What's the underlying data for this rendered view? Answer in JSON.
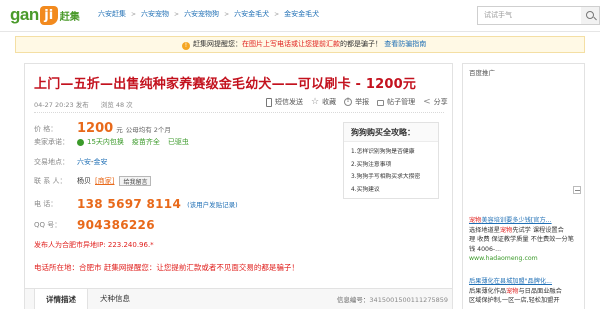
{
  "header": {
    "logo_text": "gan",
    "logo_badge": "ji",
    "logo_cn": "赶集",
    "breadcrumbs": [
      "六安赶集",
      "六安宠物",
      "六安宠物狗",
      "六安金毛犬",
      "金安金毛犬"
    ],
    "search_placeholder": "试试手气"
  },
  "notice": {
    "prefix": "赶集网提醒您：",
    "red_text": "在图片上写电话或让您提前汇款",
    "suffix": "的都是骗子！",
    "link": "查看防骗指南"
  },
  "listing": {
    "title": "上门—五折—出售纯种家养赛级金毛幼犬——可以刷卡 - 1200元",
    "date": "04-27 20:23 发布",
    "views": "浏览 48 次",
    "actions": [
      "短信发送",
      "收藏",
      "举报",
      "帖子管理",
      "分享"
    ],
    "price_label": "价    格：",
    "price": "1200",
    "price_unit": "元",
    "price_extra": "公母均有 2个月",
    "promise_label": "卖家承诺：",
    "promises": [
      "15天内包换",
      "疫苗齐全",
      "已驱虫"
    ],
    "location_label": "交易地点：",
    "location_city": "六安",
    "location_sep": " - ",
    "location_area": "金安",
    "contact_label": "联 系 人：",
    "contact_name": "杨贝",
    "contact_role": "[商家]",
    "chat_label": "给我留言",
    "phone_label": "电     话：",
    "phone": "138 5697 8114",
    "phone_link": "(该用户发贴记录)",
    "qq_label": "QQ    号：",
    "qq": "904386226",
    "ip_text": "发布人为合肥市异地IP: 223.240.96.*",
    "warning": "电话所在地：合肥市 赶集网提醒您：让您提前汇款或者不见面交易的都是骗子！"
  },
  "tips": {
    "title": "狗狗购买全攻略：",
    "items": [
      "1.怎样识别狗狗是否健康",
      "2.买狗注意事项",
      "3.狗狗手写相购买求大攒密",
      "4.买狗建议"
    ]
  },
  "tabs": {
    "active": "详情描述",
    "other": "犬种信息",
    "post_no_label": "信息编号：",
    "post_no": "3415001500111275859"
  },
  "ad": {
    "title": "百度推广",
    "blocks": [
      {
        "head_red": "宠物",
        "head": "美容培训要多少钱[官方...",
        "desc_pre": "选择地道星",
        "desc_red": "宠物",
        "desc_post": "先试学 课程设置合",
        "desc2": "理 收费 保证教学质量 不住费效一分笔",
        "desc3": "钱 4006-...",
        "url": "www.hadaomeng.com"
      },
      {
        "head": "后果薄化在县城加盟\"品牌化...",
        "desc_pre": "后果薄化作品",
        "desc_red": "宠物",
        "desc_post": "与日品面业融合",
        "desc2": "区域保护制,一区一店,轻松加盟开",
        "desc3": "",
        "url": ""
      }
    ]
  },
  "colors": {
    "accent_red": "#c3121e",
    "price_orange": "#e8691a",
    "link_blue": "#1f6fb5",
    "brand_green": "#4a9a2a"
  }
}
